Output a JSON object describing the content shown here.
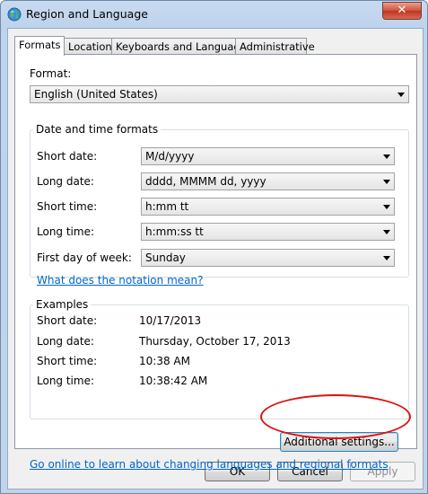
{
  "window": {
    "title": "Region and Language",
    "close_label": "✕"
  },
  "tabs": [
    {
      "label": "Formats",
      "active": true
    },
    {
      "label": "Location",
      "active": false
    },
    {
      "label": "Keyboards and Languages",
      "active": false
    },
    {
      "label": "Administrative",
      "active": false
    }
  ],
  "format": {
    "label": "Format:",
    "value": "English (United States)"
  },
  "datetime": {
    "group_title": "Date and time formats",
    "short_date": {
      "label": "Short date:",
      "value": "M/d/yyyy"
    },
    "long_date": {
      "label": "Long date:",
      "value": "dddd, MMMM dd, yyyy"
    },
    "short_time": {
      "label": "Short time:",
      "value": "h:mm tt"
    },
    "long_time": {
      "label": "Long time:",
      "value": "h:mm:ss tt"
    },
    "first_day": {
      "label": "First day of week:",
      "value": "Sunday"
    },
    "notation_link": "What does the notation mean?"
  },
  "examples": {
    "group_title": "Examples",
    "short_date": {
      "label": "Short date:",
      "value": "10/17/2013"
    },
    "long_date": {
      "label": "Long date:",
      "value": "Thursday, October 17, 2013"
    },
    "short_time": {
      "label": "Short time:",
      "value": "10:38 AM"
    },
    "long_time": {
      "label": "Long time:",
      "value": "10:38:42 AM"
    }
  },
  "additional_settings_label": "Additional settings...",
  "online_link": "Go online to learn about changing languages and regional formats",
  "buttons": {
    "ok": "OK",
    "cancel": "Cancel",
    "apply": "Apply"
  },
  "colors": {
    "link": "#0066cc",
    "annotation": "#e01010",
    "titlebar": "#c8daf0"
  }
}
